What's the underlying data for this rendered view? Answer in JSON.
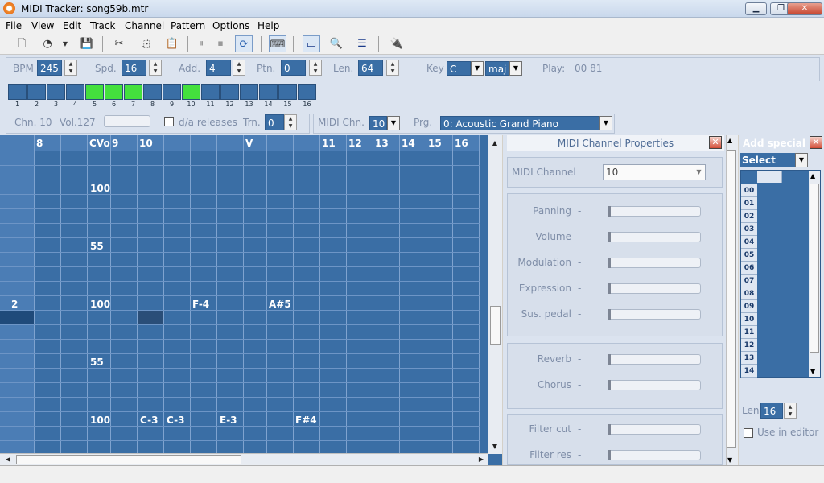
{
  "window": {
    "title": "MIDI Tracker: song59b.mtr",
    "min": "▁",
    "max": "❐",
    "close": "✕"
  },
  "menu": [
    "File",
    "View",
    "Edit",
    "Track",
    "Channel",
    "Pattern",
    "Options",
    "Help"
  ],
  "toolbar": [
    "new-file-icon",
    "open-file-icon",
    "dropdown-arrow-icon",
    "save-icon",
    "cut-icon",
    "copy-icon",
    "paste-icon",
    "pause-icon",
    "stop-icon",
    "loop-icon",
    "keyboard-icon",
    "edit-view-icon",
    "properties-icon",
    "list-view-icon",
    "midi-plug-icon"
  ],
  "params": {
    "bpm_label": "BPM",
    "bpm": "245",
    "spd_label": "Spd.",
    "spd": "16",
    "add_label": "Add.",
    "add": "4",
    "ptn_label": "Ptn.",
    "ptn": "0",
    "len_label": "Len.",
    "len": "64",
    "key_label": "Key",
    "key": "C",
    "mode": "maj",
    "play_label": "Play:",
    "play_value": "00 81"
  },
  "tracks": {
    "numbers": [
      "1",
      "2",
      "3",
      "4",
      "5",
      "6",
      "7",
      "8",
      "9",
      "10",
      "11",
      "12",
      "13",
      "14",
      "15",
      "16"
    ],
    "active": [
      5,
      6,
      7,
      10
    ]
  },
  "channel": {
    "chn": "Chn. 10",
    "vol": "Vol.127",
    "da_releases": "d/a releases",
    "trn_label": "Trn.",
    "trn": "0",
    "midi_chn_label": "MIDI Chn.",
    "midi_chn": "10",
    "prg_label": "Prg.",
    "prg": "0: Acoustic Grand Piano"
  },
  "grid": {
    "headers": [
      "8",
      "",
      "CVo",
      "9",
      "10",
      "",
      "",
      "",
      "V",
      "",
      "",
      "11",
      "12",
      "13",
      "14",
      "15",
      "16"
    ],
    "rowlabels": {
      "row10": "2"
    },
    "cells": {
      "r2_cvo": "100",
      "r6_cvo": "55",
      "r10_cvo": "100",
      "r10_f4": "F-4",
      "r10_as5": "A#5",
      "r14_cvo": "55",
      "r18_cvo": "100",
      "r18_c3a": "C-3",
      "r18_c3b": "C-3",
      "r18_e3": "E-3",
      "r18_fs4": "F#4"
    }
  },
  "props": {
    "title": "MIDI Channel Properties",
    "midi_channel_label": "MIDI Channel",
    "midi_channel": "10",
    "sliders": [
      {
        "label": "Panning",
        "dash": "-"
      },
      {
        "label": "Volume",
        "dash": "-"
      },
      {
        "label": "Modulation",
        "dash": "-"
      },
      {
        "label": "Expression",
        "dash": "-"
      },
      {
        "label": "Sus. pedal",
        "dash": "-"
      },
      {
        "label": "Reverb",
        "dash": "-"
      },
      {
        "label": "Chorus",
        "dash": "-"
      },
      {
        "label": "Filter cut",
        "dash": "-"
      },
      {
        "label": "Filter res",
        "dash": "-"
      }
    ]
  },
  "special": {
    "title": "Add special",
    "select": "Select",
    "rows": [
      "00",
      "01",
      "02",
      "03",
      "04",
      "05",
      "06",
      "07",
      "08",
      "09",
      "10",
      "11",
      "12",
      "13",
      "14"
    ],
    "len_label": "Len",
    "len": "16",
    "use_in_editor": "Use in editor"
  }
}
